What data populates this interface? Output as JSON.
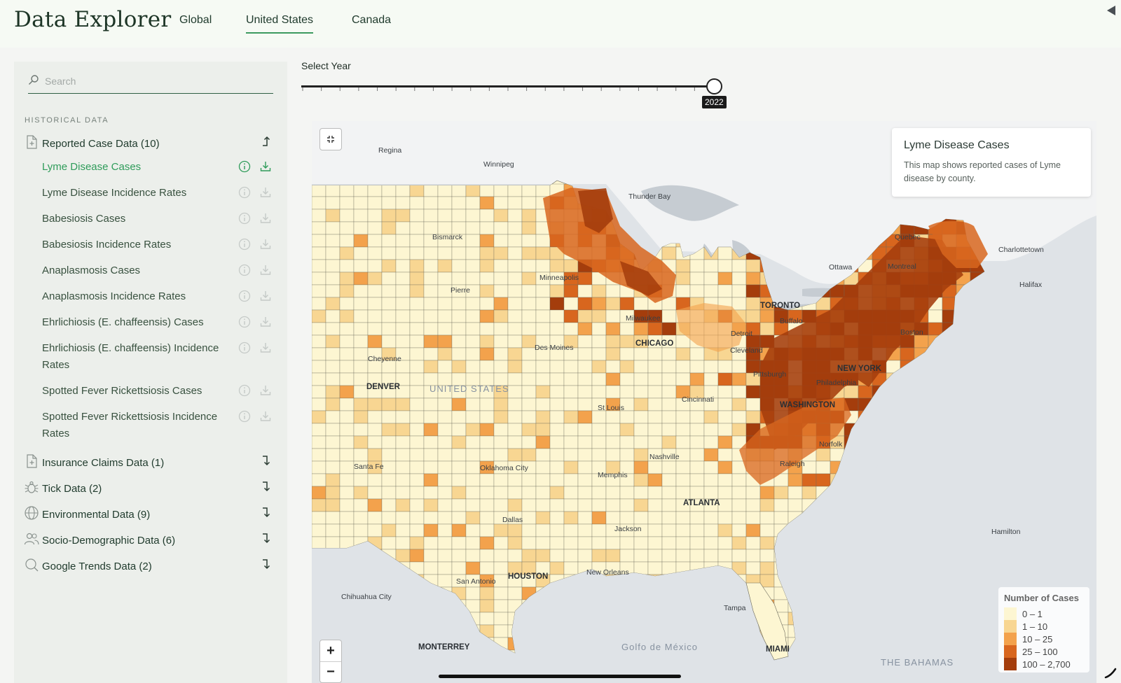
{
  "header": {
    "brand": "Data Explorer",
    "tabs": [
      {
        "label": "Global",
        "active": false
      },
      {
        "label": "United States",
        "active": true
      },
      {
        "label": "Canada",
        "active": false
      }
    ]
  },
  "sidebar": {
    "search_placeholder": "Search",
    "section_label": "HISTORICAL DATA",
    "groups": [
      {
        "label": "Reported Case Data (10)",
        "icon": "document-plus-icon",
        "expanded": true
      },
      {
        "label": "Insurance Claims Data (1)",
        "icon": "document-plus-icon",
        "expanded": false
      },
      {
        "label": "Tick Data (2)",
        "icon": "tick-icon",
        "expanded": false
      },
      {
        "label": "Environmental Data (9)",
        "icon": "globe-icon",
        "expanded": false
      },
      {
        "label": "Socio-Demographic Data (6)",
        "icon": "users-icon",
        "expanded": false
      },
      {
        "label": "Google Trends Data (2)",
        "icon": "search-icon",
        "expanded": false
      }
    ],
    "reported_items": [
      {
        "label": "Lyme Disease Cases",
        "active": true
      },
      {
        "label": "Lyme Disease Incidence Rates",
        "active": false
      },
      {
        "label": "Babesiosis Cases",
        "active": false
      },
      {
        "label": "Babesiosis Incidence Rates",
        "active": false
      },
      {
        "label": "Anaplasmosis Cases",
        "active": false
      },
      {
        "label": "Anaplasmosis Incidence Rates",
        "active": false
      },
      {
        "label": "Ehrlichiosis (E. chaffeensis) Cases",
        "active": false
      },
      {
        "label": "Ehrlichiosis (E. chaffeensis) Incidence Rates",
        "active": false
      },
      {
        "label": "Spotted Fever Rickettsiosis Cases",
        "active": false
      },
      {
        "label": "Spotted Fever Rickettsiosis Incidence Rates",
        "active": false
      }
    ]
  },
  "year_slider": {
    "label": "Select Year",
    "value": "2022",
    "position_fraction": 1.0
  },
  "map": {
    "info_title": "Lyme Disease Cases",
    "info_description": "This map shows reported cases of Lyme disease by county.",
    "legend_title": "Number of Cases",
    "legend": [
      {
        "label": "0 – 1",
        "color": "#fdf6d2"
      },
      {
        "label": "1 – 10",
        "color": "#f8d692"
      },
      {
        "label": "10 – 25",
        "color": "#f3a24c"
      },
      {
        "label": "25 – 100",
        "color": "#d8661e"
      },
      {
        "label": "100 – 2,700",
        "color": "#a43d0c"
      }
    ],
    "zoom_in": "+",
    "zoom_out": "−",
    "place_labels": [
      "Regina",
      "Winnipeg",
      "Thunder Bay",
      "Bismarck",
      "Quebec",
      "Charlottetown",
      "Ottawa",
      "Montreal",
      "Halifax",
      "Minneapolis",
      "Pierre",
      "TORONTO",
      "Milwaukee",
      "Buffalo",
      "Detroit",
      "CHICAGO",
      "Boston",
      "Des Moines",
      "Cleveland",
      "Cheyenne",
      "NEW YORK",
      "Pittsburgh",
      "Philadelphia",
      "DENVER",
      "UNITED STATES",
      "Cincinnati",
      "WASHINGTON",
      "St Louis",
      "Norfolk",
      "Nashville",
      "Santa Fe",
      "Oklahoma City",
      "Raleigh",
      "Memphis",
      "ATLANTA",
      "Dallas",
      "Jackson",
      "Hamilton",
      "New Orleans",
      "HOUSTON",
      "San Antonio",
      "Chihuahua City",
      "Tampa",
      "MIAMI",
      "MONTERREY",
      "Golfo de México",
      "THE BAHAMAS"
    ]
  }
}
